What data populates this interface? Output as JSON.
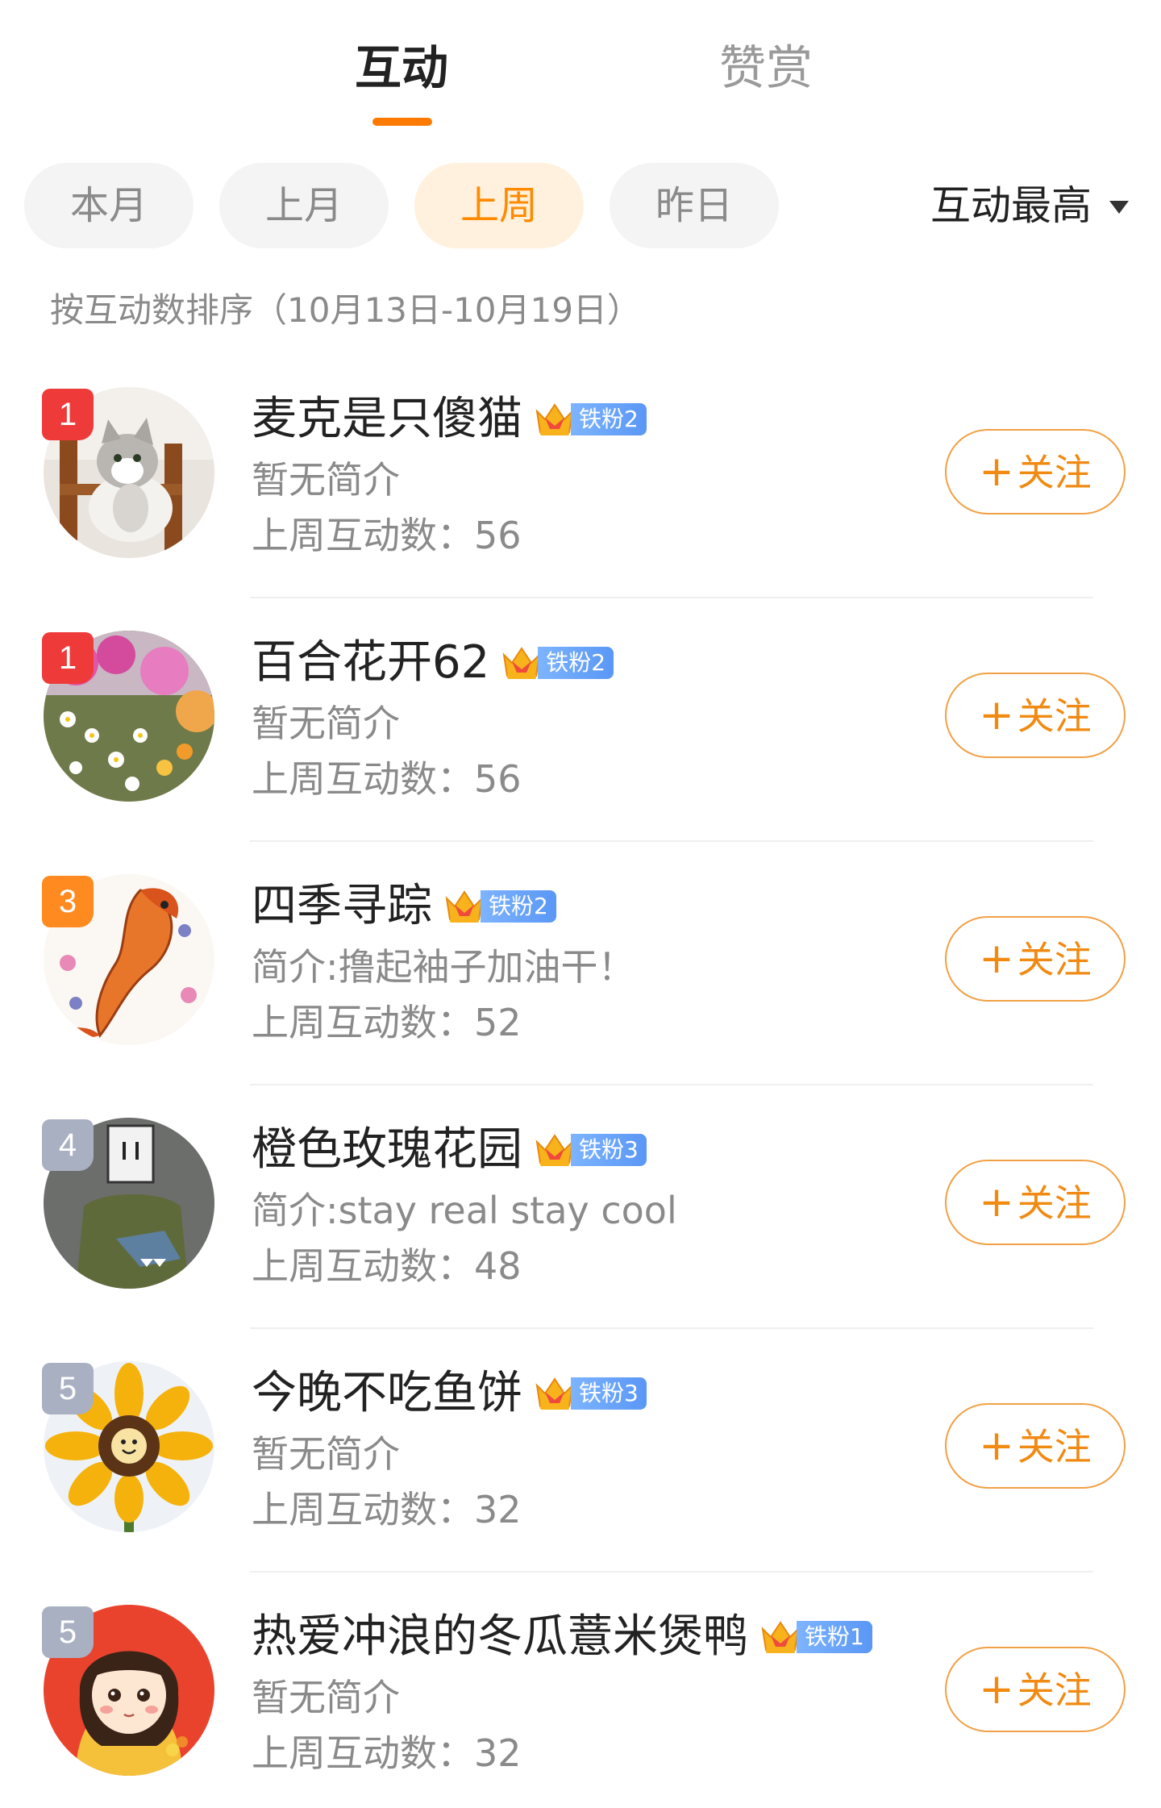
{
  "tabs": [
    {
      "label": "互动",
      "active": true
    },
    {
      "label": "赞赏",
      "active": false
    }
  ],
  "filters": [
    {
      "label": "本月",
      "active": false
    },
    {
      "label": "上月",
      "active": false
    },
    {
      "label": "上周",
      "active": true
    },
    {
      "label": "昨日",
      "active": false
    }
  ],
  "sort": {
    "label": "互动最高",
    "icon": "caret-down-icon"
  },
  "sort_description": "按互动数排序（10月13日-10月19日）",
  "follow_label": "关注",
  "colors": {
    "accent": "#ff8a00",
    "rank_red": "#ef3a3a",
    "rank_orange": "#ff8a1f",
    "rank_gray": "#a9b0c2",
    "fan_badge": "#5a97f5"
  },
  "users": [
    {
      "rank": "1",
      "name": "麦克是只傻猫",
      "fan_level": "铁粉2",
      "intro": "暂无简介",
      "count": "上周互动数：56",
      "avatar": "cat-avatar"
    },
    {
      "rank": "1",
      "name": "百合花开62",
      "fan_level": "铁粉2",
      "intro": "暂无简介",
      "count": "上周互动数：56",
      "avatar": "flowers-avatar"
    },
    {
      "rank": "3",
      "name": "四季寻踪",
      "fan_level": "铁粉2",
      "intro": "简介:撸起袖子加油干！",
      "count": "上周互动数：52",
      "avatar": "koi-fish-avatar"
    },
    {
      "rank": "4",
      "name": "橙色玫瑰花园",
      "fan_level": "铁粉3",
      "intro": "简介:stay real stay cool",
      "count": "上周互动数：48",
      "avatar": "cartoon-figure-avatar"
    },
    {
      "rank": "5",
      "name": "今晚不吃鱼饼",
      "fan_level": "铁粉3",
      "intro": "暂无简介",
      "count": "上周互动数：32",
      "avatar": "sunflower-avatar"
    },
    {
      "rank": "5",
      "name": "热爱冲浪的冬瓜薏米煲鸭",
      "fan_level": "铁粉1",
      "intro": "暂无简介",
      "count": "上周互动数：32",
      "avatar": "girl-illustration-avatar"
    }
  ]
}
